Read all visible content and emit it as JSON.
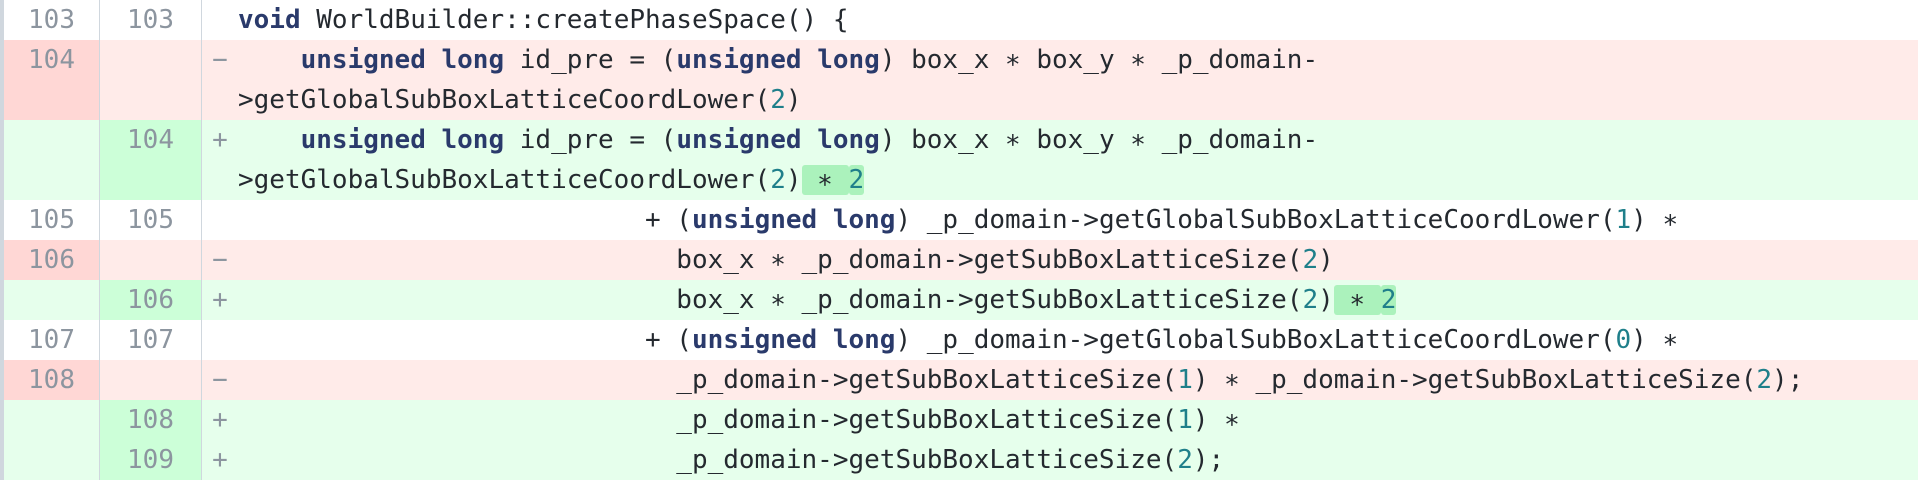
{
  "rows": [
    {
      "old": "103",
      "new": "103",
      "marker": "",
      "type": "ctx",
      "parts": [
        {
          "t": "void",
          "c": "kw"
        },
        {
          "t": " WorldBuilder::createPhaseSpace() {"
        }
      ]
    },
    {
      "old": "104",
      "new": "",
      "marker": "−",
      "type": "del",
      "lines": [
        [
          {
            "t": "    "
          },
          {
            "t": "unsigned long",
            "c": "kw"
          },
          {
            "t": " id_pre = ("
          },
          {
            "t": "unsigned long",
            "c": "kw"
          },
          {
            "t": ") box_x ∗ box_y ∗ _p_domain-"
          }
        ],
        [
          {
            "t": ">getGlobalSubBoxLatticeCoordLower("
          },
          {
            "t": "2",
            "c": "num"
          },
          {
            "t": ")"
          }
        ]
      ]
    },
    {
      "old": "",
      "new": "104",
      "marker": "+",
      "type": "add",
      "lines": [
        [
          {
            "t": "    "
          },
          {
            "t": "unsigned long",
            "c": "kw"
          },
          {
            "t": " id_pre = ("
          },
          {
            "t": "unsigned long",
            "c": "kw"
          },
          {
            "t": ") box_x ∗ box_y ∗ _p_domain-"
          }
        ],
        [
          {
            "t": ">getGlobalSubBoxLatticeCoordLower("
          },
          {
            "t": "2",
            "c": "num"
          },
          {
            "t": ")"
          },
          {
            "t": " ∗ ",
            "c": "hl"
          },
          {
            "t": "2",
            "c": "hl num"
          }
        ]
      ]
    },
    {
      "old": "105",
      "new": "105",
      "marker": "",
      "type": "ctx",
      "parts": [
        {
          "t": "                          + ("
        },
        {
          "t": "unsigned long",
          "c": "kw"
        },
        {
          "t": ") _p_domain->getGlobalSubBoxLatticeCoordLower("
        },
        {
          "t": "1",
          "c": "num"
        },
        {
          "t": ") ∗"
        }
      ]
    },
    {
      "old": "106",
      "new": "",
      "marker": "−",
      "type": "del",
      "parts": [
        {
          "t": "                            box_x ∗ _p_domain->getSubBoxLatticeSize("
        },
        {
          "t": "2",
          "c": "num"
        },
        {
          "t": ")"
        }
      ]
    },
    {
      "old": "",
      "new": "106",
      "marker": "+",
      "type": "add",
      "parts": [
        {
          "t": "                            box_x ∗ _p_domain->getSubBoxLatticeSize("
        },
        {
          "t": "2",
          "c": "num"
        },
        {
          "t": ")"
        },
        {
          "t": " ∗ ",
          "c": "hl"
        },
        {
          "t": "2",
          "c": "hl num"
        }
      ]
    },
    {
      "old": "107",
      "new": "107",
      "marker": "",
      "type": "ctx",
      "parts": [
        {
          "t": "                          + ("
        },
        {
          "t": "unsigned long",
          "c": "kw"
        },
        {
          "t": ") _p_domain->getGlobalSubBoxLatticeCoordLower("
        },
        {
          "t": "0",
          "c": "num"
        },
        {
          "t": ") ∗"
        }
      ]
    },
    {
      "old": "108",
      "new": "",
      "marker": "−",
      "type": "del",
      "parts": [
        {
          "t": "                            _p_domain->getSubBoxLatticeSize("
        },
        {
          "t": "1",
          "c": "num"
        },
        {
          "t": ") ∗ _p_domain->getSubBoxLatticeSize("
        },
        {
          "t": "2",
          "c": "num"
        },
        {
          "t": ");"
        }
      ]
    },
    {
      "old": "",
      "new": "108",
      "marker": "+",
      "type": "add",
      "parts": [
        {
          "t": "                            _p_domain->getSubBoxLatticeSize("
        },
        {
          "t": "1",
          "c": "num"
        },
        {
          "t": ") ∗"
        }
      ]
    },
    {
      "old": "",
      "new": "109",
      "marker": "+",
      "type": "add",
      "parts": [
        {
          "t": "                            _p_domain->getSubBoxLatticeSize("
        },
        {
          "t": "2",
          "c": "num"
        },
        {
          "t": ");"
        }
      ]
    }
  ]
}
